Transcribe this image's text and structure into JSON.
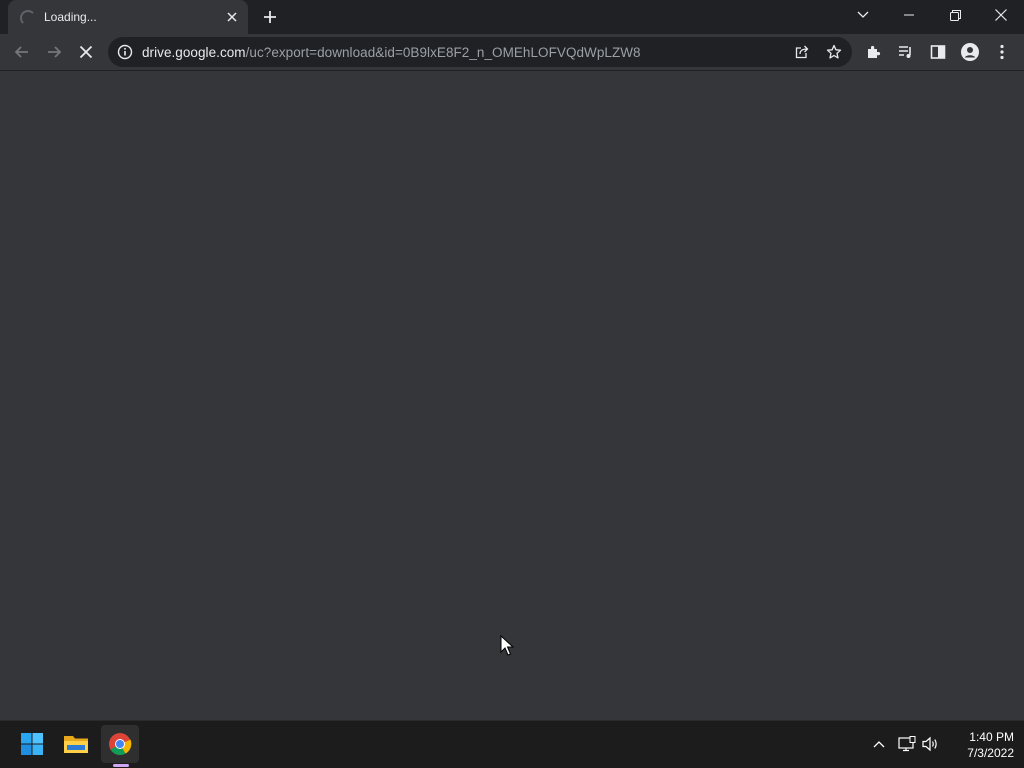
{
  "browser": {
    "tab": {
      "title": "Loading...",
      "loading": true,
      "close_icon": "close-icon"
    },
    "new_tab_icon": "plus-icon",
    "window_controls": [
      "tab-search-icon",
      "minimize-icon",
      "restore-icon",
      "close-icon"
    ],
    "toolbar": {
      "back_icon": "arrow-left-icon",
      "forward_icon": "arrow-right-icon",
      "stop_icon": "stop-x-icon",
      "site_info_icon": "info-icon",
      "url_host": "drive.google.com",
      "url_path": "/uc?export=download&id=0B9lxE8F2_n_OMEhLOFVQdWpLZW8",
      "share_icon": "share-icon",
      "bookmark_icon": "star-icon",
      "extensions_icon": "puzzle-icon",
      "media_icon": "media-queue-icon",
      "side_panel_icon": "side-panel-icon",
      "profile_icon": "profile-icon",
      "menu_icon": "kebab-menu-icon"
    }
  },
  "page": {
    "background": "#35363a",
    "status": "blank-loading"
  },
  "taskbar": {
    "apps": [
      {
        "name": "start",
        "icon": "windows-start-icon"
      },
      {
        "name": "file-explorer",
        "icon": "folder-icon"
      },
      {
        "name": "chrome",
        "icon": "chrome-icon",
        "active": true
      }
    ],
    "tray": {
      "icons": [
        "chevron-up-icon",
        "network-icon",
        "volume-icon"
      ],
      "time": "1:40 PM",
      "date": "7/3/2022"
    }
  },
  "colors": {
    "tabstrip": "#202124",
    "toolbar": "#35363a",
    "omnibox": "#202124",
    "text_primary": "#e8eaed",
    "text_secondary": "#9aa0a6",
    "taskbar": "#1c1c1c",
    "accent_indicator": "#d0a6f5"
  }
}
